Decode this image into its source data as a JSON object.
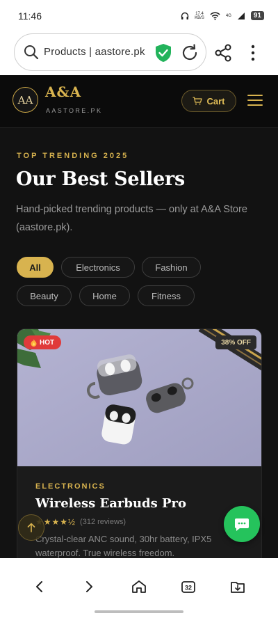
{
  "status_bar": {
    "time": "11:46",
    "net_speed": "17.4",
    "net_unit": "KB/S",
    "signal": "4G",
    "battery": "91"
  },
  "browser": {
    "url": "Products | aastore.pk"
  },
  "header": {
    "logo_monogram": "AA",
    "brand_name": "A&A",
    "brand_sub": "AASTORE.PK",
    "cart_label": "Cart"
  },
  "hero": {
    "eyebrow": "TOP TRENDING 2025",
    "title": "Our Best Sellers",
    "description": "Hand-picked trending products — only at A&A Store (aastore.pk)."
  },
  "categories": [
    "All",
    "Electronics",
    "Fashion",
    "Beauty",
    "Home",
    "Fitness"
  ],
  "active_category": "All",
  "product": {
    "badge": "HOT",
    "discount": "38% OFF",
    "category": "ELECTRONICS",
    "name": "Wireless Earbuds Pro",
    "rating": 4.5,
    "stars": "★★★★½",
    "reviews": "(312 reviews)",
    "description": "Crystal-clear ANC sound, 30hr battery, IPX5 waterproof. True wireless freedom."
  },
  "colors": {
    "gold": "#D8B34F",
    "background": "#121212",
    "hot": "#E03A3A",
    "whatsapp": "#25C35C"
  }
}
